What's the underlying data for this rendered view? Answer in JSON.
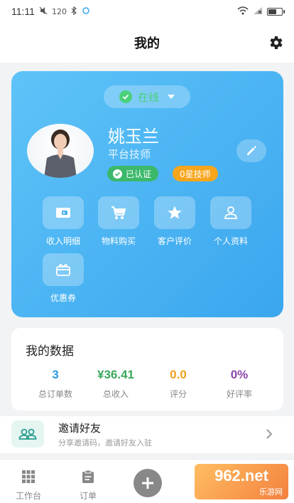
{
  "status_bar": {
    "time": "11:11",
    "speed": "120",
    "battery_level": 0.6
  },
  "header": {
    "title": "我的"
  },
  "profile": {
    "online_status": "在线",
    "name": "姚玉兰",
    "role": "平台技师",
    "verified_badge": "已认证",
    "level_badge": "0星技师",
    "colors": {
      "card_gradient_start": "#5ec3f8",
      "card_gradient_end": "#3aa6ee",
      "online_green": "#4bd07a",
      "verified_green": "#3cb86a",
      "level_orange": "#f7a51c"
    }
  },
  "quick_actions": [
    {
      "label": "收入明细",
      "icon": "wallet-icon"
    },
    {
      "label": "物料购买",
      "icon": "cart-icon"
    },
    {
      "label": "客户评价",
      "icon": "star-icon"
    },
    {
      "label": "个人资料",
      "icon": "person-icon"
    },
    {
      "label": "优惠券",
      "icon": "gift-icon"
    }
  ],
  "my_data": {
    "title": "我的数据",
    "stats": [
      {
        "value": "3",
        "label": "总订单数",
        "color": "#2f9be3"
      },
      {
        "value": "¥36.41",
        "label": "总收入",
        "color": "#3aa85c"
      },
      {
        "value": "0.0",
        "label": "评分",
        "color": "#f0a020"
      },
      {
        "value": "0%",
        "label": "好评率",
        "color": "#8e44ad"
      }
    ]
  },
  "invite": {
    "title": "邀请好友",
    "subtitle": "分享邀请码，邀请好友入驻"
  },
  "tabbar": {
    "tabs": [
      {
        "label": "工作台",
        "icon": "grid-icon"
      },
      {
        "label": "订单",
        "icon": "clipboard-icon"
      }
    ]
  },
  "watermark": {
    "big": "962.net",
    "small": "乐游网"
  }
}
